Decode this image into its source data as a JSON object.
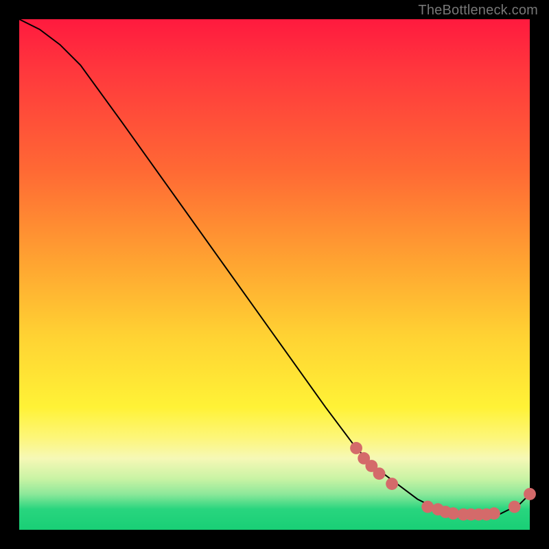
{
  "watermark": "TheBottleneck.com",
  "chart_data": {
    "type": "line",
    "title": "",
    "xlabel": "",
    "ylabel": "",
    "xlim": [
      0,
      100
    ],
    "ylim": [
      0,
      100
    ],
    "series": [
      {
        "name": "curve",
        "x": [
          0,
          4,
          8,
          12,
          20,
          30,
          40,
          50,
          60,
          66,
          70,
          74,
          78,
          82,
          86,
          90,
          94,
          98,
          100
        ],
        "y": [
          100,
          98,
          95,
          91,
          80,
          66,
          52,
          38,
          24,
          16,
          12,
          9,
          6,
          4,
          3,
          3,
          3,
          5,
          7
        ]
      }
    ],
    "markers": [
      {
        "x": 66.0,
        "y": 16.0
      },
      {
        "x": 67.5,
        "y": 14.0
      },
      {
        "x": 69.0,
        "y": 12.5
      },
      {
        "x": 70.5,
        "y": 11.0
      },
      {
        "x": 73.0,
        "y": 9.0
      },
      {
        "x": 80.0,
        "y": 4.5
      },
      {
        "x": 82.0,
        "y": 4.0
      },
      {
        "x": 83.5,
        "y": 3.5
      },
      {
        "x": 85.0,
        "y": 3.2
      },
      {
        "x": 87.0,
        "y": 3.0
      },
      {
        "x": 88.5,
        "y": 3.0
      },
      {
        "x": 90.0,
        "y": 3.0
      },
      {
        "x": 91.5,
        "y": 3.0
      },
      {
        "x": 93.0,
        "y": 3.2
      },
      {
        "x": 97.0,
        "y": 4.5
      },
      {
        "x": 100.0,
        "y": 7.0
      }
    ],
    "marker_color": "#d46a6a",
    "curve_color": "#000000",
    "gradient_stops": [
      {
        "pct": 0,
        "color": "#ff1a3e"
      },
      {
        "pct": 30,
        "color": "#ff6a34"
      },
      {
        "pct": 62,
        "color": "#ffd233"
      },
      {
        "pct": 82,
        "color": "#fdf67a"
      },
      {
        "pct": 93,
        "color": "#8de89a"
      },
      {
        "pct": 100,
        "color": "#19cf76"
      }
    ]
  }
}
